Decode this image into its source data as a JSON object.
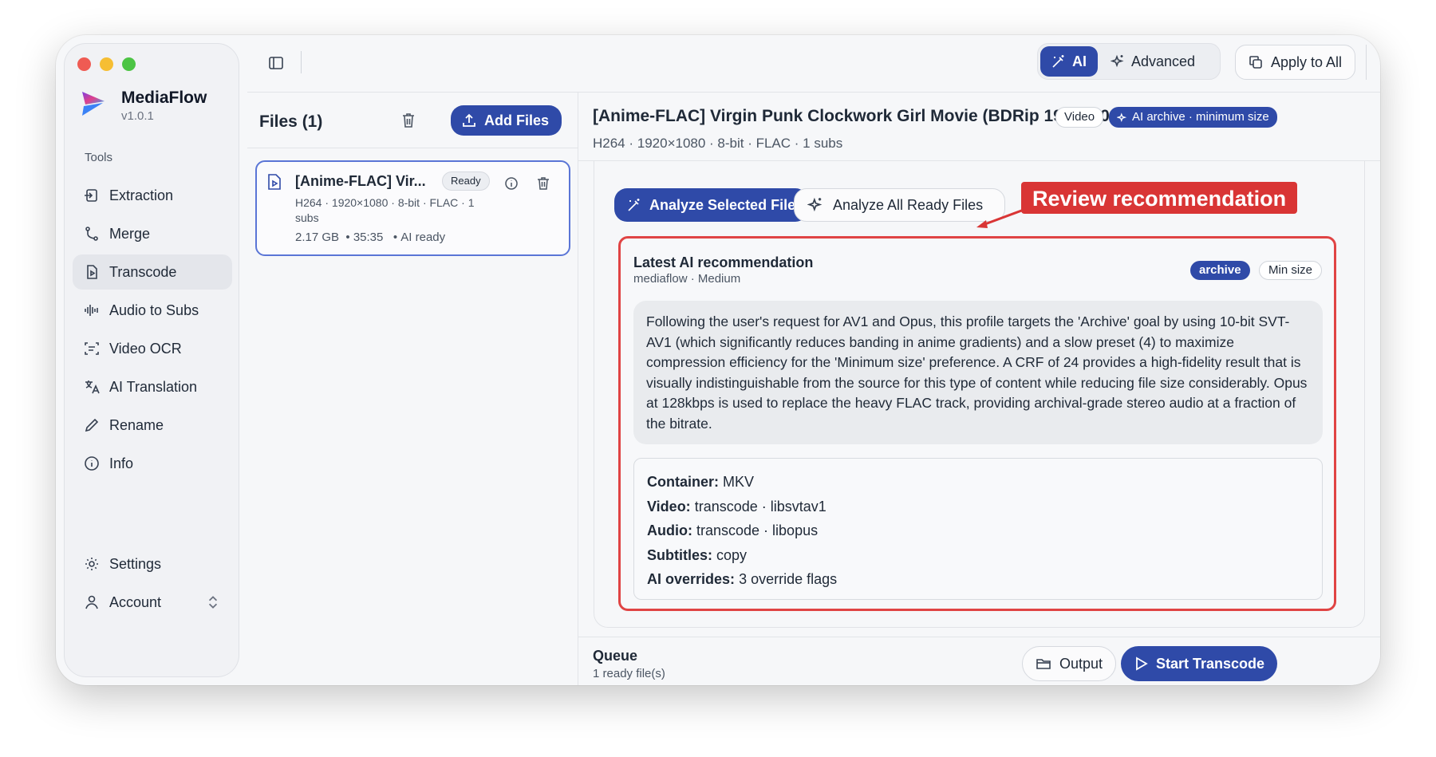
{
  "app": {
    "name": "MediaFlow",
    "version": "v1.0.1"
  },
  "sidebar": {
    "section_label": "Tools",
    "items": [
      {
        "label": "Extraction",
        "icon": "extraction-icon"
      },
      {
        "label": "Merge",
        "icon": "merge-icon"
      },
      {
        "label": "Transcode",
        "icon": "transcode-icon",
        "active": true
      },
      {
        "label": "Audio to Subs",
        "icon": "waveform-icon"
      },
      {
        "label": "Video OCR",
        "icon": "ocr-icon"
      },
      {
        "label": "AI Translation",
        "icon": "translate-icon"
      },
      {
        "label": "Rename",
        "icon": "pencil-icon"
      },
      {
        "label": "Info",
        "icon": "info-icon"
      }
    ],
    "settings_label": "Settings",
    "account_label": "Account"
  },
  "toolbar": {
    "mode_ai": "AI",
    "mode_advanced": "Advanced",
    "apply_all": "Apply to All"
  },
  "files": {
    "title": "Files (1)",
    "add_label": "Add Files",
    "items": [
      {
        "name": "[Anime-FLAC] Vir...",
        "status": "Ready",
        "meta": "H264 · 1920×1080 · 8-bit · FLAC · 1 subs",
        "size": "2.17 GB",
        "duration": "35:35",
        "ai_state": "AI ready"
      }
    ]
  },
  "main": {
    "title": "[Anime-FLAC] Virgin Punk Clockwork Girl Movie (BDRip 1920×10...",
    "badge_type": "Video",
    "badge_ai": "AI archive · minimum size",
    "subtitle": "H264 · 1920×1080 · 8-bit · FLAC · 1 subs",
    "analyze_selected": "Analyze Selected File",
    "analyze_all": "Analyze All Ready Files"
  },
  "recommendation": {
    "title": "Latest AI recommendation",
    "source": "mediaflow · Medium",
    "tag_goal": "archive",
    "tag_pref": "Min size",
    "text": "Following the user's request for AV1 and Opus, this profile targets the 'Archive' goal by using 10-bit SVT-AV1 (which significantly reduces banding in anime gradients) and a slow preset (4) to maximize compression efficiency for the 'Minimum size' preference. A CRF of 24 provides a high-fidelity result that is visually indistinguishable from the source for this type of content while reducing file size considerably. Opus at 128kbps is used to replace the heavy FLAC track, providing archival-grade stereo audio at a fraction of the bitrate.",
    "details": [
      {
        "label": "Container:",
        "value": "MKV"
      },
      {
        "label": "Video:",
        "value": "transcode · libsvtav1"
      },
      {
        "label": "Audio:",
        "value": "transcode · libopus"
      },
      {
        "label": "Subtitles:",
        "value": "copy"
      },
      {
        "label": "AI overrides:",
        "value": "3 override flags"
      }
    ]
  },
  "annotation": {
    "callout": "Review recommendation",
    "color": "#d93535"
  },
  "queue": {
    "title": "Queue",
    "status": "1 ready file(s)",
    "output_label": "Output",
    "start_label": "Start Transcode"
  },
  "colors": {
    "accent": "#2f4aa8",
    "highlight_border": "#e04444"
  }
}
